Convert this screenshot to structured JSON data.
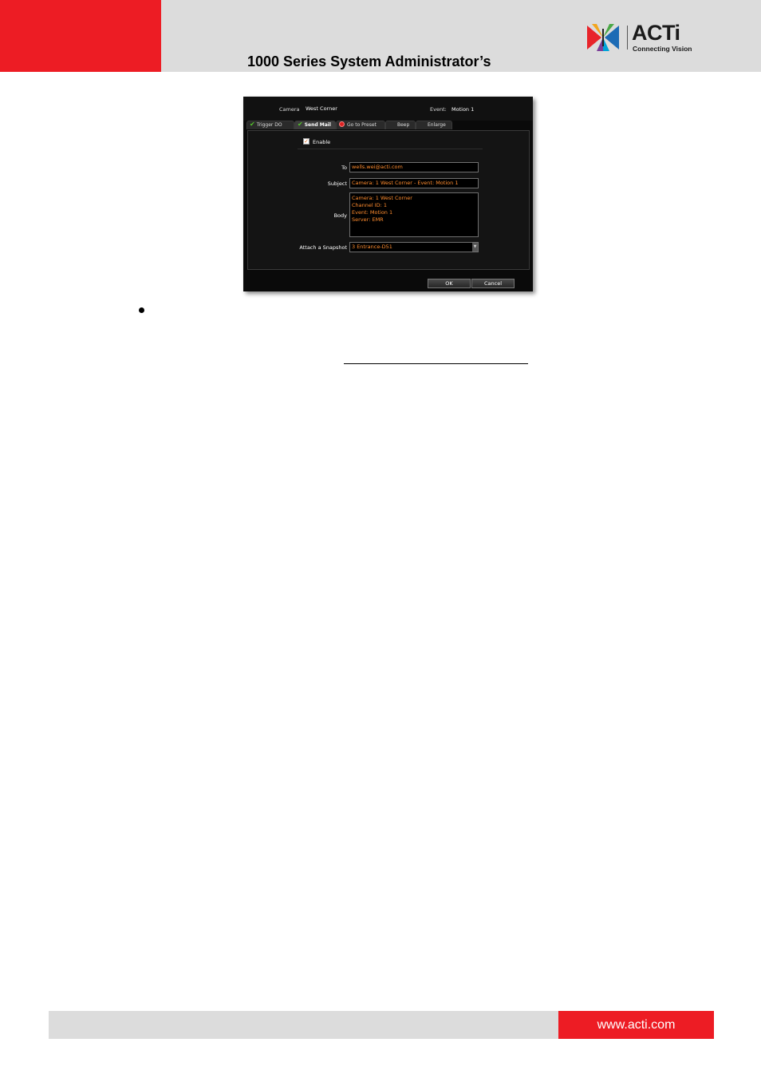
{
  "header": {
    "title": "1000 Series System Administrator’s",
    "logo_text": "ACTi",
    "logo_tagline": "Connecting Vision"
  },
  "dialog": {
    "camera_label": "Camera",
    "camera_value": "West Corner",
    "event_label": "Event:",
    "event_value": "Motion 1",
    "tabs": [
      {
        "label": "Trigger DO",
        "icon": "check-icon"
      },
      {
        "label": "Send Mail",
        "icon": "check-icon",
        "active": true
      },
      {
        "label": "Go to Preset",
        "icon": "stop-icon"
      },
      {
        "label": "Beep"
      },
      {
        "label": "Enlarge"
      }
    ],
    "enable_label": "Enable",
    "to_label": "To",
    "to_value": "wells.wei@acti.com",
    "subject_label": "Subject",
    "subject_value": "Camera: 1 West Corner - Event: Motion 1",
    "body_label": "Body",
    "body_lines": [
      "Camera: 1 West Corner",
      "Channel ID: 1",
      "Event: Motion 1",
      "Server: EMR"
    ],
    "snapshot_label": "Attach a Snapshot",
    "snapshot_value": "3 Entrance-D51",
    "ok_label": "OK",
    "cancel_label": "Cancel",
    "accent_color": "#ff8c2e"
  },
  "footer": {
    "url": "www.acti.com"
  }
}
